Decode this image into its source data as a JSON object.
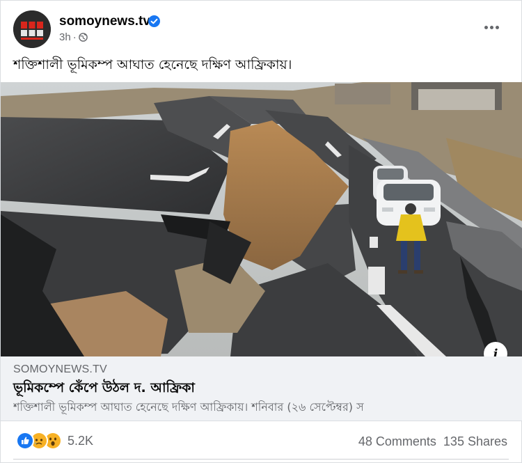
{
  "post": {
    "page_name": "somoynews.tv",
    "time": "3h",
    "caption": "শক্তিশালী ভূমিকম্প আঘাত হেনেছে দক্ষিণ আফ্রিকায়।"
  },
  "link_preview": {
    "domain": "SOMOYNEWS.TV",
    "title": "ভূমিকম্পে কেঁপে উঠল দ. আফ্রিকা",
    "description": "শক্তিশালী ভূমিকম্প আঘাত হেনেছে দক্ষিণ আফ্রিকায়। শনিবার (২৬ সেপ্টেম্বর) স"
  },
  "footer": {
    "reaction_count": "5.2K",
    "comments": "48 Comments",
    "shares": "135 Shares"
  },
  "icons": {
    "verified": "verified-badge-icon",
    "privacy": "globe-icon",
    "more": "more-horizontal-icon",
    "info": "info-icon",
    "reactions": [
      "like-icon",
      "sad-icon",
      "wow-icon"
    ]
  },
  "colors": {
    "facebook_blue": "#1877f2",
    "secondary_text": "#65676b",
    "link_box_bg": "#f0f2f5"
  }
}
